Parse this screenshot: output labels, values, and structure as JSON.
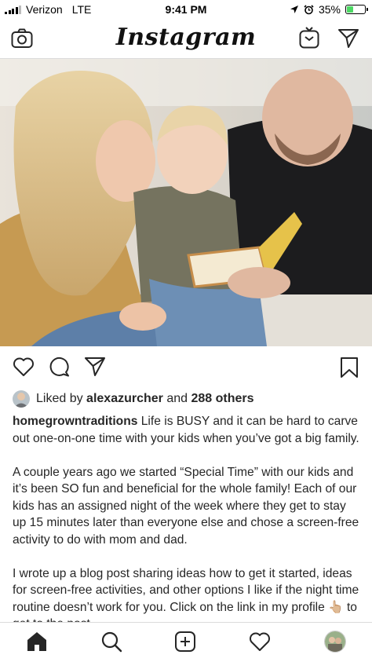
{
  "status_bar": {
    "carrier": "Verizon",
    "network": "LTE",
    "time": "9:41 PM",
    "battery_percent": "35%",
    "battery_level": 0.35
  },
  "nav": {
    "logo": "Instagram",
    "icons": [
      "camera-icon",
      "igtv-icon",
      "direct-message-icon"
    ]
  },
  "post": {
    "actions": [
      "like-icon",
      "comment-icon",
      "share-icon",
      "bookmark-icon"
    ],
    "likes": {
      "prefix": "Liked by",
      "user": "alexazurcher",
      "joiner": "and",
      "others": "288 others"
    },
    "caption": {
      "username": "homegrowntraditions",
      "p1": "Life is BUSY and it can be hard to carve out one-on-one time with your kids when you’ve got a big family.",
      "p2": "A couple years ago we started “Special Time” with our kids and it’s been SO fun and beneficial for the whole family! Each of our kids has an assigned night of the week where they get to stay up 15 minutes later than everyone else and chose a screen-free activity to do with mom and dad.",
      "p3_before": "I wrote up a blog post sharing ideas how to get it started, ideas for screen-free activities, and other options I like if the night time routine doesn’t work for you. Click on the link in my profile",
      "p3_emoji": "👆🏼",
      "p3_after": "to get to the post."
    }
  },
  "tab_bar": {
    "items": [
      "home-icon",
      "search-icon",
      "new-post-icon",
      "activity-icon",
      "profile-avatar"
    ]
  },
  "colors": {
    "text": "#262626",
    "border": "#dbdbdb",
    "battery": "#4cd964"
  }
}
